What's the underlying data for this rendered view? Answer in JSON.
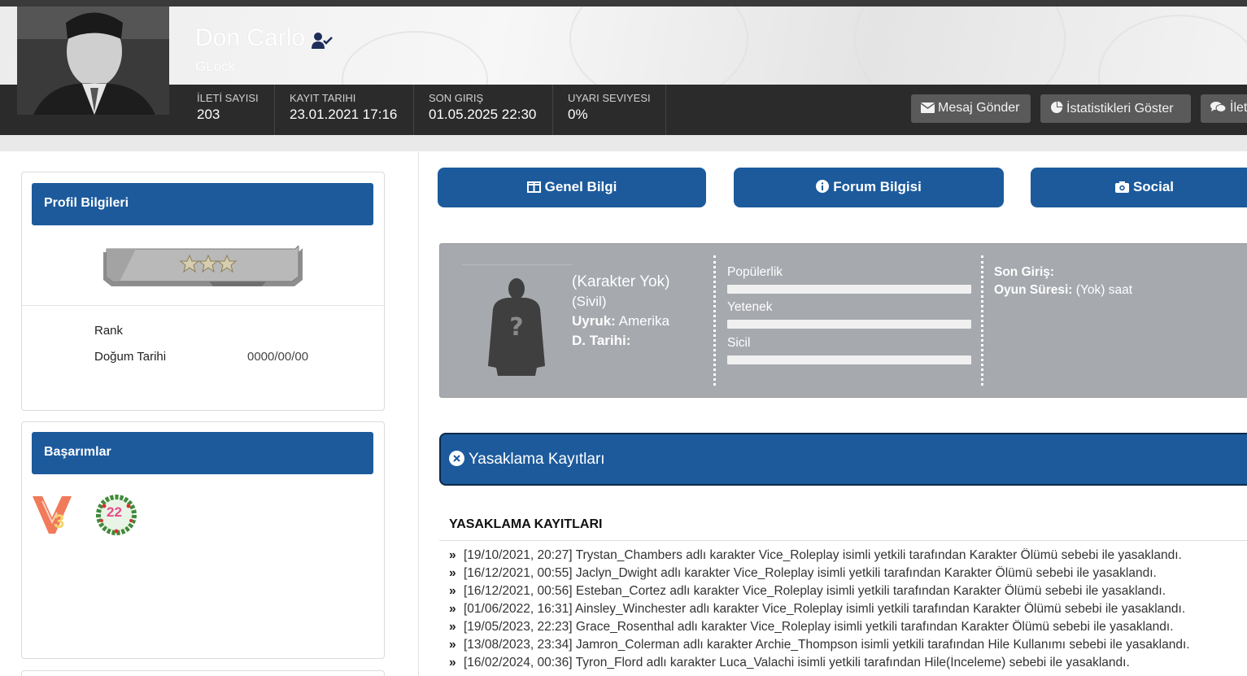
{
  "profile": {
    "username": "Don Carlo",
    "usergroup": "GLock"
  },
  "stats": [
    {
      "label": "İLETİ SAYISI",
      "value": "203"
    },
    {
      "label": "KAYIT TARIHI",
      "value": "23.01.2021 17:16"
    },
    {
      "label": "SON GIRIŞ",
      "value": "01.05.2025 22:30"
    },
    {
      "label": "UYARI SEVIYESI",
      "value": "0%"
    }
  ],
  "actions": {
    "message": "Mesaj Gönder",
    "statistics": "İstatistikleri Göster",
    "posts": "İleti"
  },
  "sidebar": {
    "profile_header": "Profil Bilgileri",
    "rank_label": "Rank",
    "birth_label": "Doğum Tarihi",
    "birth_value": "0000/00/00",
    "achievements_header": "Başarımlar",
    "badge_number": "3",
    "badge2_number": "22"
  },
  "tabs": {
    "general": "Genel Bilgi",
    "forum": "Forum Bilgisi",
    "social": "Social"
  },
  "character": {
    "name": "(Karakter Yok)",
    "status": "(Sivil)",
    "nationality_label": "Uyruk:",
    "nationality_value": "Amerika",
    "birth_label": "D. Tarihi:",
    "popularity_label": "Popülerlik",
    "skill_label": "Yetenek",
    "record_label": "Sicil",
    "last_login_label": "Son Giriş:",
    "playtime_label": "Oyun Süresi:",
    "playtime_value": "(Yok) saat",
    "popularity": 0,
    "skill": 0,
    "record": 0
  },
  "bans": {
    "header": "Yasaklama Kayıtları",
    "title": "YASAKLAMA KAYITLARI",
    "items": [
      "[19/10/2021, 20:27] Trystan_Chambers adlı karakter Vice_Roleplay isimli yetkili tarafından Karakter Ölümü sebebi ile yasaklandı.",
      "[16/12/2021, 00:55] Jaclyn_Dwight adlı karakter Vice_Roleplay isimli yetkili tarafından Karakter Ölümü sebebi ile yasaklandı.",
      "[16/12/2021, 00:56] Esteban_Cortez adlı karakter Vice_Roleplay isimli yetkili tarafından Karakter Ölümü sebebi ile yasaklandı.",
      "[01/06/2022, 16:31] Ainsley_Winchester adlı karakter Vice_Roleplay isimli yetkili tarafından Karakter Ölümü sebebi ile yasaklandı.",
      "[19/05/2023, 22:23] Grace_Rosenthal adlı karakter Vice_Roleplay isimli yetkili tarafından Karakter Ölümü sebebi ile yasaklandı.",
      "[13/08/2023, 23:34] Jamron_Colerman adlı karakter Archie_Thompson isimli yetkili tarafından Hile Kullanımı sebebi ile yasaklandı.",
      "[16/02/2024, 00:36] Tyron_Flord adlı karakter Luca_Valachi isimli yetkili tarafından Hile(İnceleme) sebebi ile yasaklandı."
    ]
  },
  "colors": {
    "accent": "#1c5a9c",
    "statbar": "#2b2b2b",
    "character_panel": "#a6a9ae"
  }
}
